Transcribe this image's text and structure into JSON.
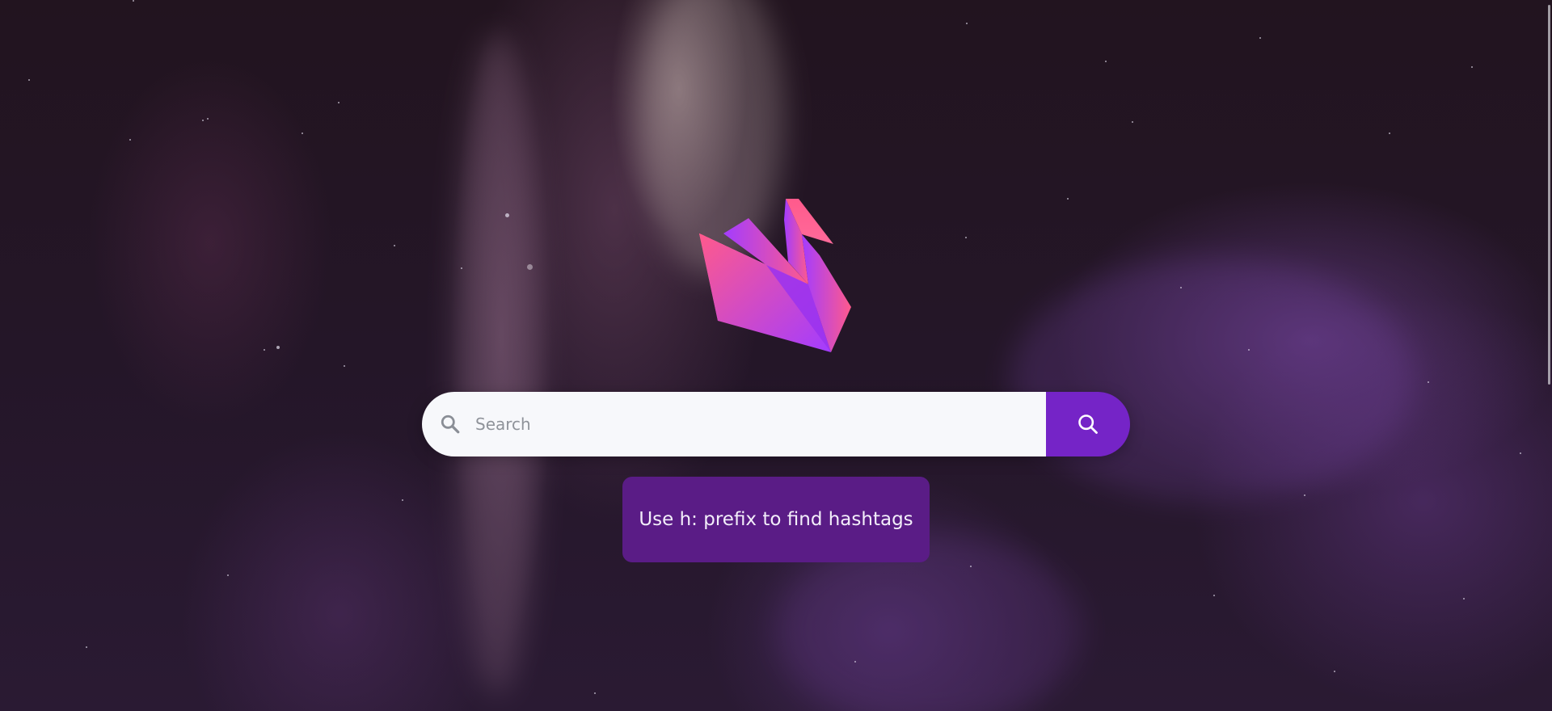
{
  "search": {
    "placeholder": "Search",
    "field_icon": "search-icon",
    "button_icon": "search-icon",
    "button_color": "#7524c7"
  },
  "hint": {
    "text": "Use h: prefix to find hashtags"
  },
  "logo": {
    "icon": "swan-logo",
    "colors": [
      "#ff5a8c",
      "#a33cff"
    ]
  }
}
